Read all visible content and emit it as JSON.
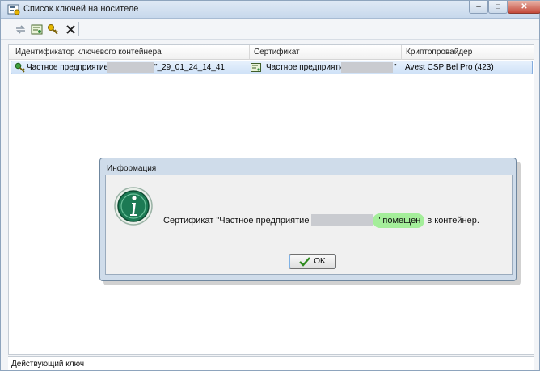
{
  "window": {
    "title": "Список ключей на носителе",
    "buttons": {
      "minimize": "–",
      "maximize": "□",
      "close": "✕"
    }
  },
  "toolbar": {
    "icons": [
      "refresh-icon",
      "certificate-icon",
      "key-icon",
      "delete-icon"
    ]
  },
  "list": {
    "columns": [
      "Идентификатор ключевого контейнера",
      "Сертификат",
      "Криптопровайдер"
    ],
    "rows": [
      {
        "container_prefix": "Частное предприятие \"",
        "container_suffix": "\"_29_01_24_14_41",
        "certificate_prefix": "Частное предприятие \"",
        "certificate_suffix": "\"",
        "provider": "Avest CSP Bel Pro (423)"
      }
    ]
  },
  "status": {
    "label": "Действующий ключ"
  },
  "dialog": {
    "title": "Информация",
    "message_prefix": "Сертификат \"Частное предприятие",
    "message_mid": "\" помещен",
    "message_suffix": " в контейнер.",
    "ok_label": "OK"
  },
  "colors": {
    "selection": "#cfe2f7",
    "highlight": "#a4ee9a",
    "info_icon": "#1c7a54"
  }
}
